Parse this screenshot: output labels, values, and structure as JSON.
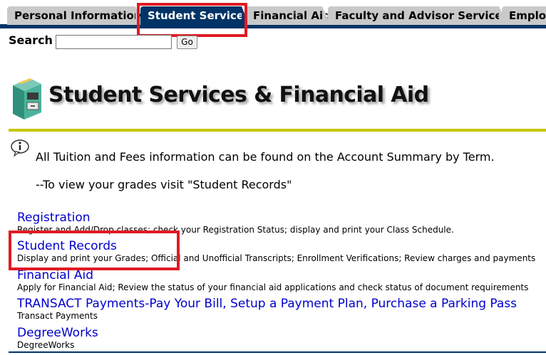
{
  "tabs": [
    {
      "label": "Personal Information",
      "active": false
    },
    {
      "label": "Student Services",
      "active": true
    },
    {
      "label": "Financial Aid",
      "active": false
    },
    {
      "label": "Faculty and Advisor Services",
      "active": false
    },
    {
      "label": "Employ",
      "active": false
    }
  ],
  "search": {
    "label": "Search",
    "value": "",
    "button": "Go"
  },
  "header": {
    "title": "Student Services & Financial Aid",
    "logo_icon": "file-cabinet-icon"
  },
  "info": {
    "icon": "info-icon",
    "line1": "All Tuition and Fees information can be found on the Account Summary by Term.",
    "line2": "--To view your grades visit \"Student Records\""
  },
  "menu": [
    {
      "label": "Registration",
      "desc": "Register and Add/Drop classes; check your Registration Status; display and print your Class Schedule."
    },
    {
      "label": "Student Records",
      "desc": "Display and print your Grades; Official and Unofficial Transcripts; Enrollment Verifications; Review charges and payments"
    },
    {
      "label": "Financial Aid",
      "desc": "Apply for Financial Aid; Review the status of your financial aid applications and check status of document requirements"
    },
    {
      "label": "TRANSACT Payments-Pay Your Bill, Setup a Payment Plan, Purchase a Parking Pass",
      "desc": "Transact Payments"
    },
    {
      "label": "DegreeWorks",
      "desc": "DegreeWorks"
    }
  ],
  "colors": {
    "nav": "#003366",
    "highlight": "#e01b24",
    "rule": "#c7c700",
    "link": "#0000cc"
  }
}
